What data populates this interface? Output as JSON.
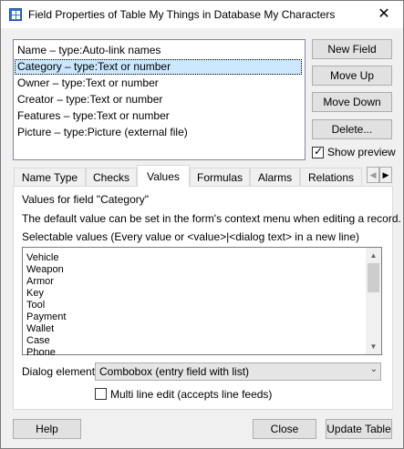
{
  "window": {
    "title": "Field Properties of Table My Things in Database My Characters",
    "close_glyph": "✕"
  },
  "fields": {
    "items": [
      {
        "label": "Name – type:Auto-link names"
      },
      {
        "label": "Category – type:Text or number",
        "selected": true
      },
      {
        "label": "Owner – type:Text or number"
      },
      {
        "label": "Creator – type:Text or number"
      },
      {
        "label": "Features – type:Text or number"
      },
      {
        "label": "Picture – type:Picture (external file)"
      }
    ]
  },
  "side_buttons": {
    "new_field": "New Field",
    "move_up": "Move Up",
    "move_down": "Move Down",
    "delete": "Delete...",
    "show_preview": "Show preview",
    "show_preview_checked": true
  },
  "tabs": [
    {
      "label": "Name  Type"
    },
    {
      "label": "Checks"
    },
    {
      "label": "Values",
      "active": true
    },
    {
      "label": "Formulas"
    },
    {
      "label": "Alarms"
    },
    {
      "label": "Relations"
    }
  ],
  "tab_scroll": {
    "left": "◀",
    "right": "▶"
  },
  "values_tab": {
    "heading": "Values for field \"Category\"",
    "info": "The default value can be set in the form's context menu when editing a record.",
    "selectable_label": "Selectable values (Every value or  <value>|<dialog text> in a new line)",
    "values": [
      "Vehicle",
      "Weapon",
      "Armor",
      "Key",
      "Tool",
      "Payment",
      "Wallet",
      "Case",
      "Phone"
    ],
    "scroll_up": "▲",
    "scroll_down": "▼",
    "dialog_element_label": "Dialog element:",
    "dialog_element_value": "Combobox (entry field with list)",
    "dropdown_glyph": "⌄",
    "multiline_label": "Multi line edit (accepts line feeds)",
    "multiline_checked": false
  },
  "footer": {
    "help": "Help",
    "close": "Close",
    "update": "Update Table"
  }
}
